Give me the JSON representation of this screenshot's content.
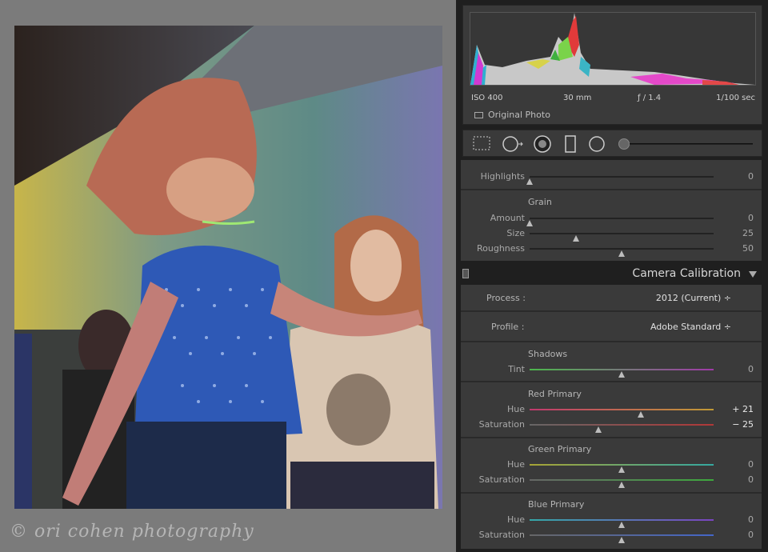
{
  "watermark": "ori cohen photography",
  "histogram": {
    "meta": {
      "iso": "ISO 400",
      "focal": "30 mm",
      "aperture": "ƒ / 1.4",
      "shutter": "1/100 sec"
    },
    "original_photo_label": "Original Photo"
  },
  "tools": {
    "crop": "crop-overlay-icon",
    "spot": "spot-removal-icon",
    "redeye": "red-eye-icon",
    "graduated": "graduated-filter-icon",
    "radial": "radial-filter-icon",
    "brush": "adjustment-brush-icon"
  },
  "effects": {
    "highlights_label": "Highlights",
    "highlights_value": "0",
    "highlights_level": 0.0,
    "grain_title": "Grain",
    "amount_label": "Amount",
    "amount_value": "0",
    "amount_level": 0.0,
    "size_label": "Size",
    "size_value": "25",
    "size_level": 0.25,
    "roughness_label": "Roughness",
    "roughness_value": "50",
    "roughness_level": 0.5
  },
  "calibration": {
    "title": "Camera Calibration",
    "process_label": "Process :",
    "process_value": "2012 (Current) ÷",
    "profile_label": "Profile :",
    "profile_value": "Adobe Standard ÷",
    "shadows_title": "Shadows",
    "tint_label": "Tint",
    "tint_value": "0",
    "tint_level": 0.5,
    "red_title": "Red Primary",
    "red_hue_label": "Hue",
    "red_hue_value": "+ 21",
    "red_hue_level": 0.605,
    "red_sat_label": "Saturation",
    "red_sat_value": "− 25",
    "red_sat_level": 0.375,
    "green_title": "Green Primary",
    "green_hue_label": "Hue",
    "green_hue_value": "0",
    "green_hue_level": 0.5,
    "green_sat_label": "Saturation",
    "green_sat_value": "0",
    "green_sat_level": 0.5,
    "blue_title": "Blue Primary",
    "blue_hue_label": "Hue",
    "blue_hue_value": "0",
    "blue_hue_level": 0.5,
    "blue_sat_label": "Saturation",
    "blue_sat_value": "0",
    "blue_sat_level": 0.5
  }
}
